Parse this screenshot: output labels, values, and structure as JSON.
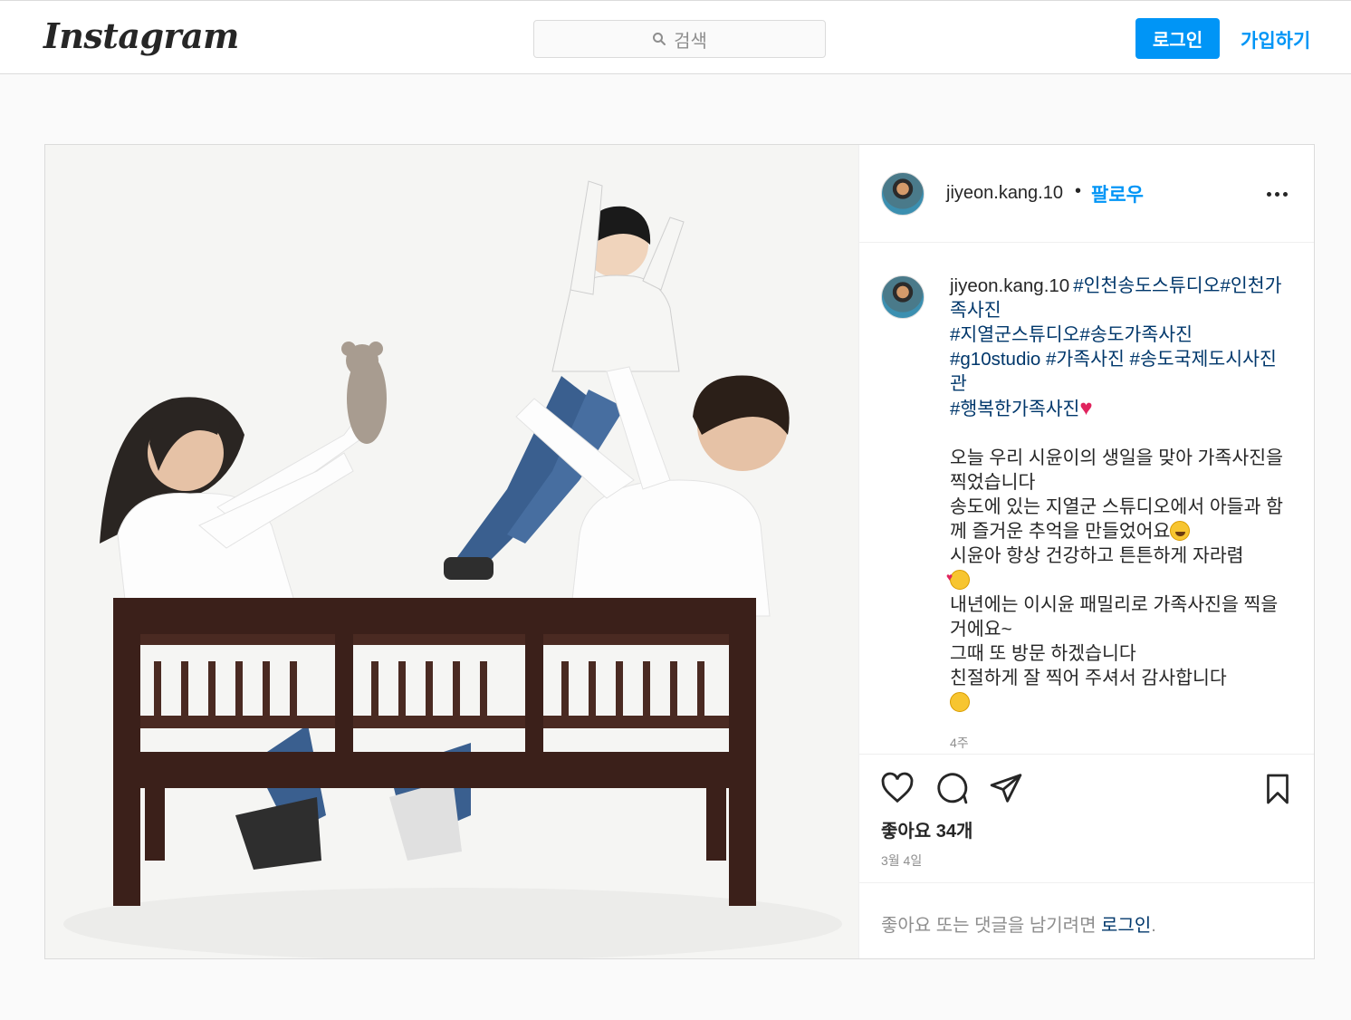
{
  "header": {
    "logo": "Instagram",
    "search_placeholder": "검색",
    "login_label": "로그인",
    "signup_label": "가입하기"
  },
  "post": {
    "username": "jiyeon.kang.10",
    "dot": "•",
    "follow_label": "팔로우",
    "caption": {
      "username": "jiyeon.kang.10",
      "hashtags_line1": "#인천송도스튜디오#인천가족사진",
      "hashtags_line2": "#지열군스튜디오#송도가족사진",
      "hashtags_line3": "#g10studio #가족사진 #송도국제도시사진관",
      "hashtags_line4": "#행복한가족사진",
      "body_line1": "오늘 우리 시윤이의 생일을 맞아 가족사진을 찍었습니다",
      "body_line2": "송도에 있는 지열군 스튜디오에서 아들과 함께 즐거운 추억을 만들었어요",
      "body_line3": "시윤아 항상 건강하고 튼튼하게 자라렴",
      "body_line4": "내년에는 이시윤 패밀리로 가족사진을 찍을거에요~",
      "body_line5": "그때 또 방문 하겠습니다",
      "body_line6": "친절하게 잘 찍어 주셔서 감사합니다"
    },
    "caption_age": "4주",
    "likes_text": "좋아요 34개",
    "date": "3월 4일",
    "comment_prompt": "좋아요 또는 댓글을 남기려면 ",
    "comment_login": "로그인",
    "comment_period": "."
  },
  "icons": [
    "search-icon",
    "more-options-icon",
    "heart-icon",
    "comment-icon",
    "share-icon",
    "bookmark-icon"
  ],
  "colors": {
    "accent": "#0095f6",
    "hashtag": "#00376b",
    "muted": "#8e8e8e",
    "border": "#dbdbdb"
  }
}
